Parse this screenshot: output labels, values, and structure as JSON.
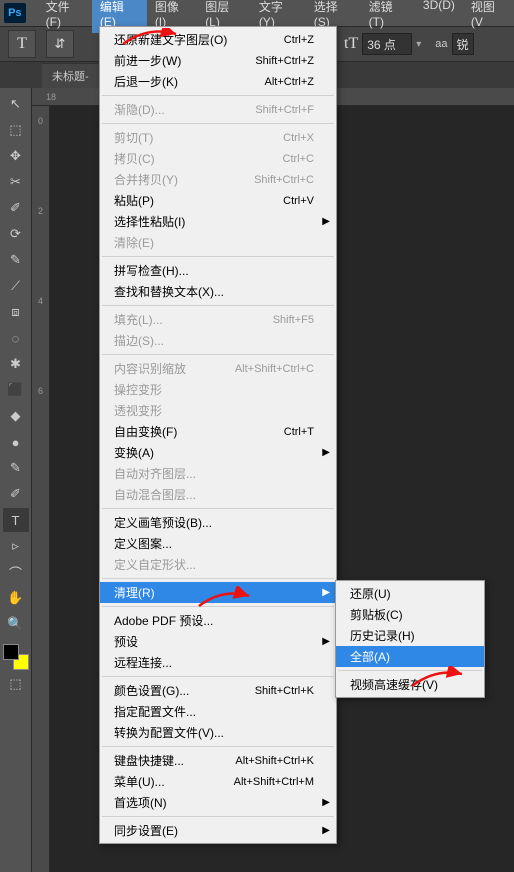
{
  "app": {
    "logo": "Ps"
  },
  "menubar": [
    "文件(F)",
    "编辑(E)",
    "图像(I)",
    "图层(L)",
    "文字(Y)",
    "选择(S)",
    "滤镜(T)",
    "3D(D)",
    "视图(V"
  ],
  "menubar_active_index": 1,
  "toolbar": {
    "font_size_icon": "tT",
    "font_size_value": "36 点",
    "aa_label": "aa",
    "sharpen_label": "锐"
  },
  "doc_tab": {
    "title": "未标题-"
  },
  "ruler_h": "18",
  "ruler_v": [
    "0",
    "2",
    "4",
    "6"
  ],
  "tools": [
    "↖",
    "⬚",
    "✥",
    "✂",
    "✐",
    "⟳",
    "✎",
    "⟋",
    "⧈",
    "◌",
    "✱",
    "⬛",
    "◆",
    "●",
    "✎",
    "✐",
    "T",
    "▹",
    "⌒",
    "✋",
    "🔍"
  ],
  "edit_menu": {
    "groups": [
      [
        {
          "label": "还原新建文字图层(O)",
          "shortcut": "Ctrl+Z"
        },
        {
          "label": "前进一步(W)",
          "shortcut": "Shift+Ctrl+Z"
        },
        {
          "label": "后退一步(K)",
          "shortcut": "Alt+Ctrl+Z"
        }
      ],
      [
        {
          "label": "渐隐(D)...",
          "shortcut": "Shift+Ctrl+F",
          "disabled": true
        }
      ],
      [
        {
          "label": "剪切(T)",
          "shortcut": "Ctrl+X",
          "disabled": true
        },
        {
          "label": "拷贝(C)",
          "shortcut": "Ctrl+C",
          "disabled": true
        },
        {
          "label": "合并拷贝(Y)",
          "shortcut": "Shift+Ctrl+C",
          "disabled": true
        },
        {
          "label": "粘贴(P)",
          "shortcut": "Ctrl+V"
        },
        {
          "label": "选择性粘贴(I)",
          "submenu": true
        },
        {
          "label": "清除(E)",
          "disabled": true
        }
      ],
      [
        {
          "label": "拼写检查(H)..."
        },
        {
          "label": "查找和替换文本(X)..."
        }
      ],
      [
        {
          "label": "填充(L)...",
          "shortcut": "Shift+F5",
          "disabled": true
        },
        {
          "label": "描边(S)...",
          "disabled": true
        }
      ],
      [
        {
          "label": "内容识别缩放",
          "shortcut": "Alt+Shift+Ctrl+C",
          "disabled": true
        },
        {
          "label": "操控变形",
          "disabled": true
        },
        {
          "label": "透视变形",
          "disabled": true
        },
        {
          "label": "自由变换(F)",
          "shortcut": "Ctrl+T"
        },
        {
          "label": "变换(A)",
          "submenu": true
        },
        {
          "label": "自动对齐图层...",
          "disabled": true
        },
        {
          "label": "自动混合图层...",
          "disabled": true
        }
      ],
      [
        {
          "label": "定义画笔预设(B)..."
        },
        {
          "label": "定义图案..."
        },
        {
          "label": "定义自定形状...",
          "disabled": true
        }
      ],
      [
        {
          "label": "清理(R)",
          "submenu": true,
          "highlight": true
        }
      ],
      [
        {
          "label": "Adobe PDF 预设..."
        },
        {
          "label": "预设",
          "submenu": true
        },
        {
          "label": "远程连接..."
        }
      ],
      [
        {
          "label": "颜色设置(G)...",
          "shortcut": "Shift+Ctrl+K"
        },
        {
          "label": "指定配置文件..."
        },
        {
          "label": "转换为配置文件(V)..."
        }
      ],
      [
        {
          "label": "键盘快捷键...",
          "shortcut": "Alt+Shift+Ctrl+K"
        },
        {
          "label": "菜单(U)...",
          "shortcut": "Alt+Shift+Ctrl+M"
        },
        {
          "label": "首选项(N)",
          "submenu": true
        }
      ],
      [
        {
          "label": "同步设置(E)",
          "submenu": true
        }
      ]
    ]
  },
  "clear_submenu": [
    {
      "label": "还原(U)"
    },
    {
      "label": "剪贴板(C)"
    },
    {
      "label": "历史记录(H)"
    },
    {
      "label": "全部(A)",
      "highlight": true
    },
    {
      "sep": true
    },
    {
      "label": "视频高速缓存(V)"
    }
  ]
}
